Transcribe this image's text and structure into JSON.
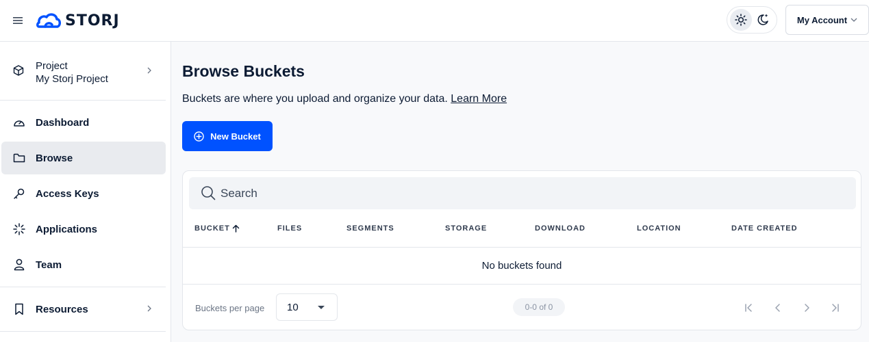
{
  "header": {
    "logo_text": "STORJ",
    "account_label": "My Account"
  },
  "sidebar": {
    "project": {
      "label": "Project",
      "name": "My Storj Project"
    },
    "items": [
      {
        "label": "Dashboard",
        "icon": "dashboard-icon"
      },
      {
        "label": "Browse",
        "icon": "folder-icon",
        "active": true
      },
      {
        "label": "Access Keys",
        "icon": "key-icon"
      },
      {
        "label": "Applications",
        "icon": "applications-icon"
      },
      {
        "label": "Team",
        "icon": "person-icon"
      },
      {
        "label": "Resources",
        "icon": "bookmark-icon"
      }
    ]
  },
  "main": {
    "title": "Browse Buckets",
    "description": "Buckets are where you upload and organize your data.",
    "learn_more": "Learn More",
    "new_bucket_label": "New Bucket",
    "search_placeholder": "Search",
    "columns": [
      "BUCKET",
      "FILES",
      "SEGMENTS",
      "STORAGE",
      "DOWNLOAD",
      "LOCATION",
      "DATE CREATED"
    ],
    "empty_text": "No buckets found",
    "footer": {
      "per_page_label": "Buckets per page",
      "per_page_value": "10",
      "range": "0-0 of 0"
    }
  },
  "colors": {
    "accent": "#0052ff",
    "text": "#0c1b33",
    "border": "#e3e6eb"
  }
}
